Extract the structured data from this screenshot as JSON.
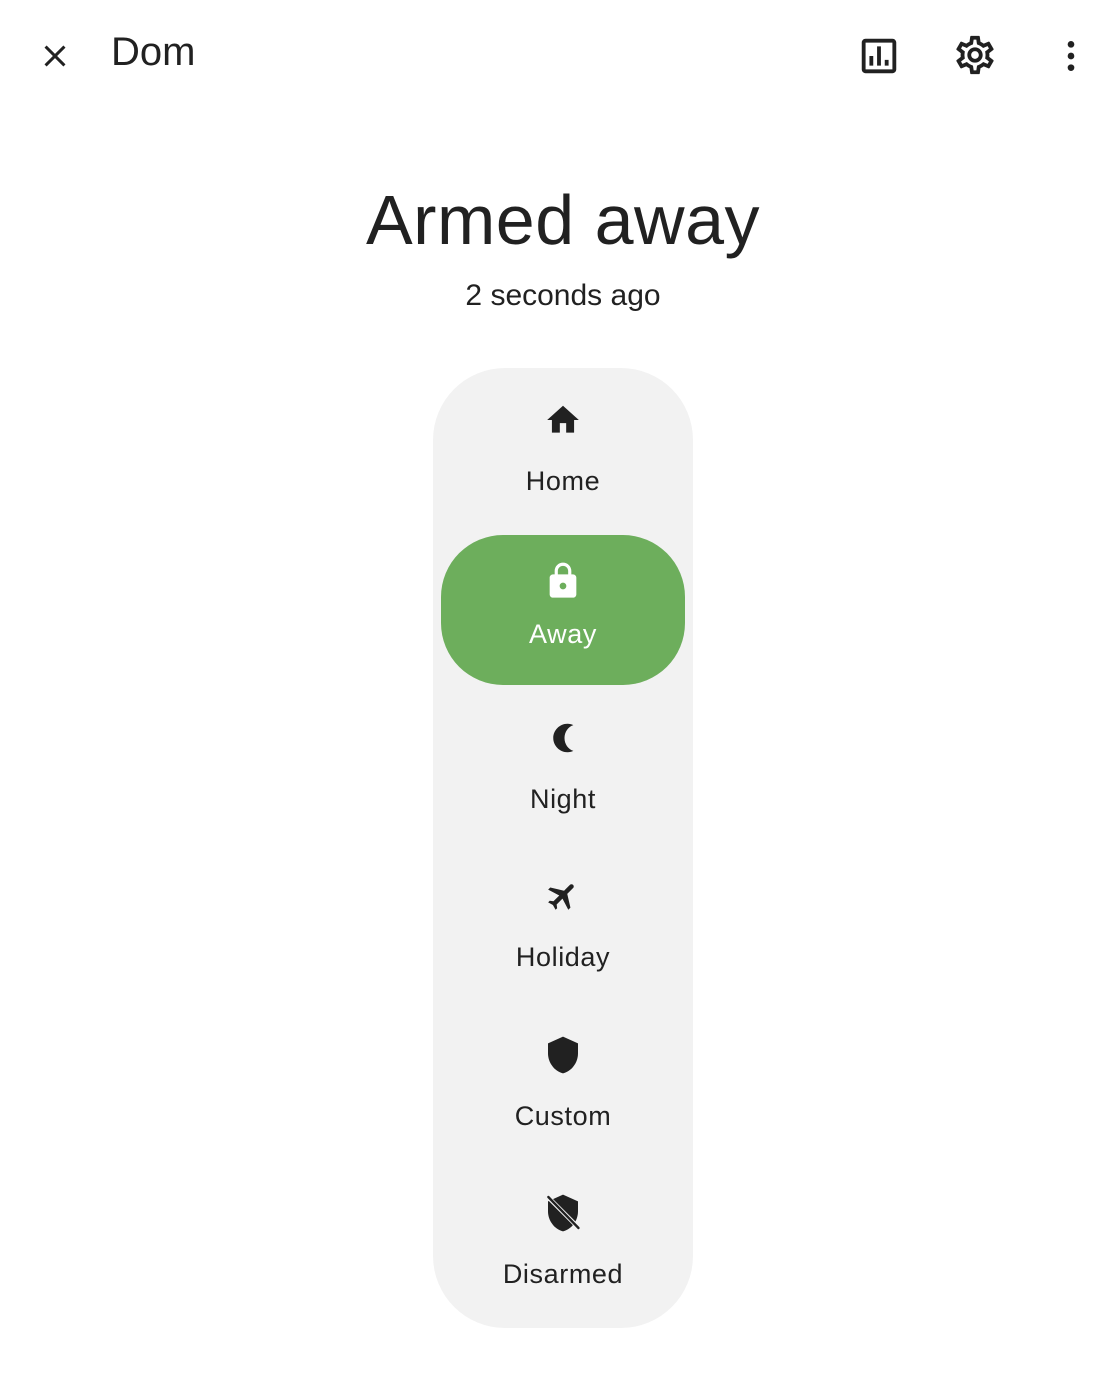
{
  "header": {
    "title": "Dom",
    "actions": {
      "close": "close-icon",
      "history": "chart-box-icon",
      "settings": "cog-icon",
      "more": "dots-vertical-icon"
    }
  },
  "state": {
    "title": "Armed away",
    "time": "2 seconds ago"
  },
  "colors": {
    "active": "#6dae5c",
    "panel": "#f2f2f2",
    "text": "#212121"
  },
  "modes": [
    {
      "label": "Home",
      "icon": "home-icon",
      "active": false
    },
    {
      "label": "Away",
      "icon": "lock-icon",
      "active": true
    },
    {
      "label": "Night",
      "icon": "moon-icon",
      "active": false
    },
    {
      "label": "Holiday",
      "icon": "airplane-icon",
      "active": false
    },
    {
      "label": "Custom",
      "icon": "shield-icon",
      "active": false
    },
    {
      "label": "Disarmed",
      "icon": "shield-off-icon",
      "active": false
    }
  ]
}
